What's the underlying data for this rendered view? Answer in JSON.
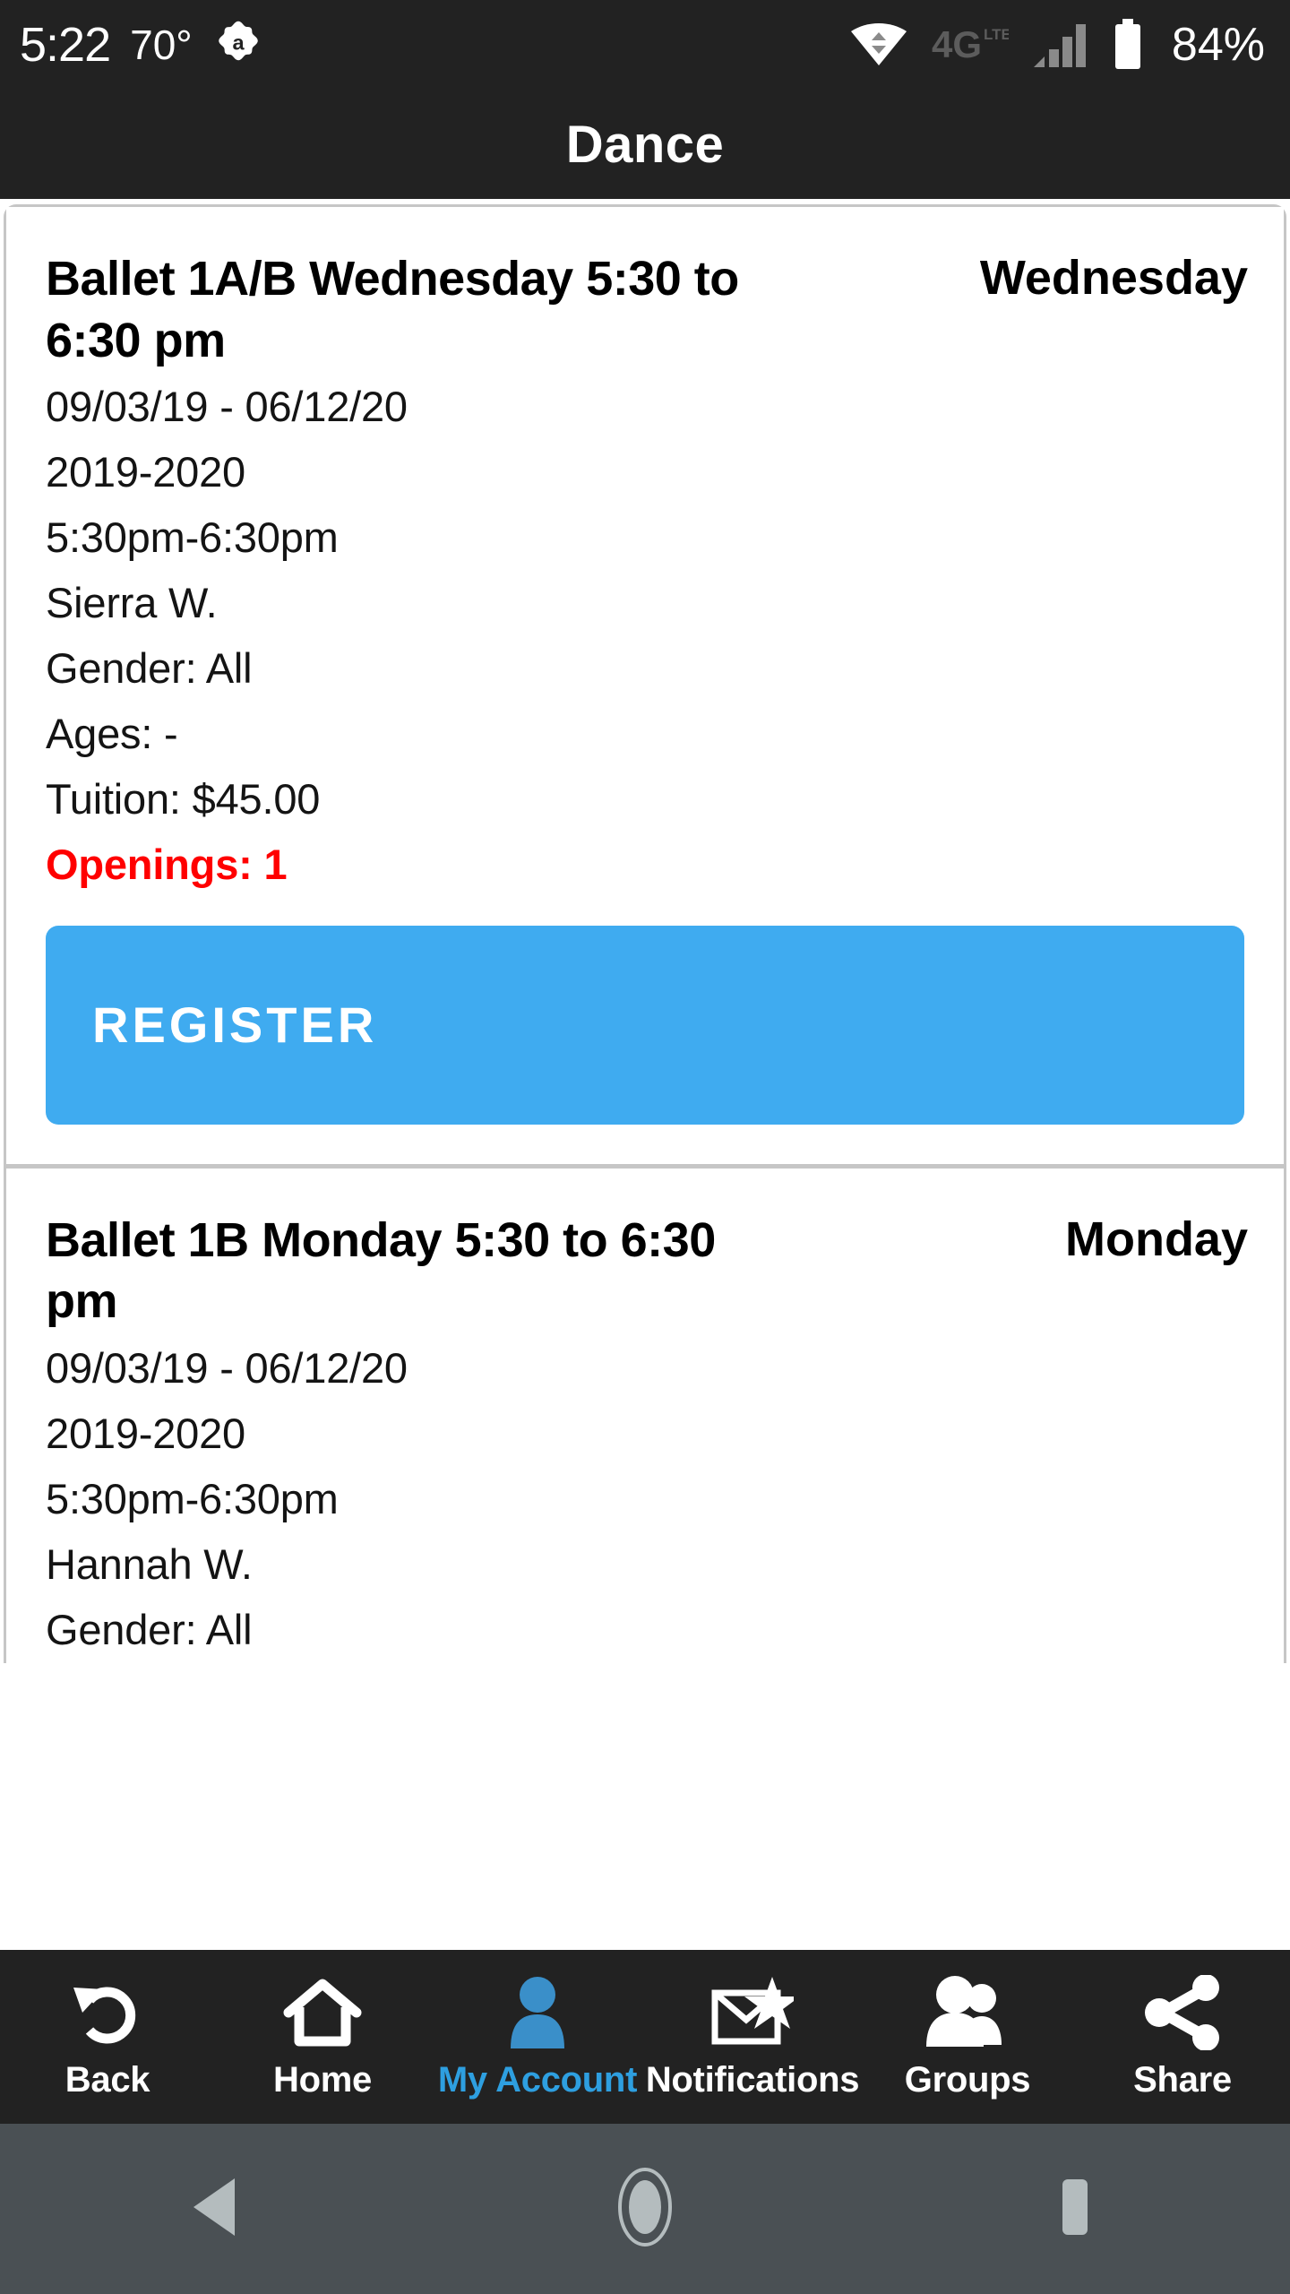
{
  "status_bar": {
    "clock": "5:22",
    "temperature": "70°",
    "avast_icon": "avast-icon",
    "wifi_icon": "wifi-icon",
    "network_type": "4G LTE",
    "network_icon": "4g-lte-icon",
    "signal_icon": "signal-bars-icon",
    "battery_icon": "battery-icon",
    "battery_percent": "84%"
  },
  "header": {
    "title": "Dance"
  },
  "classes": [
    {
      "name": "Ballet 1A/B Wednesday 5:30 to 6:30 pm",
      "day": "Wednesday",
      "date_range": "09/03/19 - 06/12/20",
      "season": "2019-2020",
      "time": "5:30pm-6:30pm",
      "instructor": "Sierra W.",
      "gender": "Gender: All",
      "ages": "Ages: -",
      "tuition": "Tuition: $45.00",
      "openings": "Openings: 1",
      "register_label": "REGISTER"
    },
    {
      "name": "Ballet 1B Monday 5:30 to 6:30 pm",
      "day": "Monday",
      "date_range": "09/03/19 - 06/12/20",
      "season": "2019-2020",
      "time": "5:30pm-6:30pm",
      "instructor": "Hannah W.",
      "gender": "Gender: All"
    }
  ],
  "bottom_nav": {
    "items": [
      {
        "label": "Back",
        "icon": "undo-arrow-icon",
        "active": false
      },
      {
        "label": "Home",
        "icon": "house-icon",
        "active": false
      },
      {
        "label": "My Account",
        "icon": "person-icon",
        "active": true
      },
      {
        "label": "Notifications",
        "icon": "envelope-star-icon",
        "active": false
      },
      {
        "label": "Groups",
        "icon": "two-people-icon",
        "active": false
      },
      {
        "label": "Share",
        "icon": "share-nodes-icon",
        "active": false
      }
    ]
  },
  "system_nav": {
    "back_icon": "triangle-back-icon",
    "home_icon": "circle-home-icon",
    "recents_icon": "square-recents-icon"
  },
  "colors": {
    "accent_blue": "#3fabf0",
    "nav_active_blue": "#2e9fe0",
    "openings_red": "#ff0000",
    "bar_dark": "#222222",
    "sysnav_gray": "#4a5054"
  }
}
